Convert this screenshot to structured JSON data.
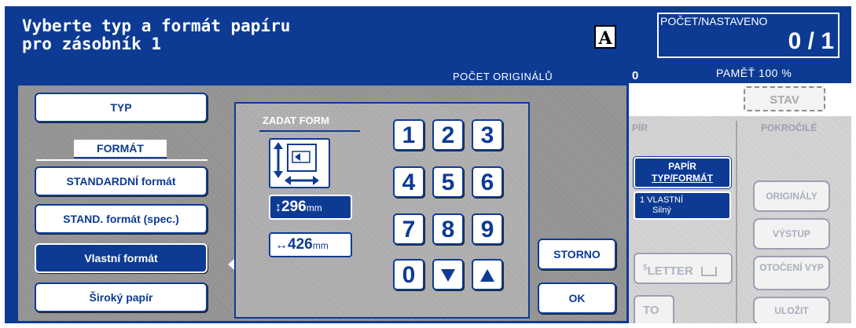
{
  "header": {
    "title": "Vyberte typ a formát papíru\npro zásobník 1",
    "mode_icon": "A",
    "count_label": "POČET/NASTAVENO",
    "count_value": "0 / 1",
    "originals_label": "POČET ORIGINÁLŮ",
    "originals_value": "0",
    "memory_label": "PAMĚŤ 100 %"
  },
  "background": {
    "status_button": "STAV",
    "column_left_header": "PÍR",
    "column_right_header": "POKROČILÉ",
    "paper_button": {
      "line1": "PAPÍR",
      "line2": "TYP/FORMÁT"
    },
    "tray_info": {
      "line1": "1 VLASTNÍ",
      "line2": "Silný"
    },
    "letter_button": "LETTER",
    "letter_superscript": "5",
    "to_button": "TO",
    "side_buttons": [
      "ORIGINÁLY",
      "VÝSTUP",
      "OTOČENÍ VYP",
      "ULOŽIT"
    ]
  },
  "popup": {
    "left_buttons": {
      "typ": "TYP",
      "format_label": "FORMÁT",
      "standard": "STANDARDNÍ formát",
      "standard_spec": "STAND. formát (spec.)",
      "custom": "Vlastní formát",
      "wide": "Široký papír"
    },
    "selected": "Vlastní formát",
    "entry": {
      "title": "ZADAT FORM",
      "height_value": "296",
      "width_value": "426",
      "unit": "mm"
    },
    "keypad": [
      "1",
      "2",
      "3",
      "4",
      "5",
      "6",
      "7",
      "8",
      "9",
      "0"
    ],
    "actions": {
      "cancel": "STORNO",
      "ok": "OK"
    }
  },
  "colors": {
    "accent": "#0d3b94",
    "panel_gray": "#8e8e8e",
    "white": "#ffffff"
  }
}
